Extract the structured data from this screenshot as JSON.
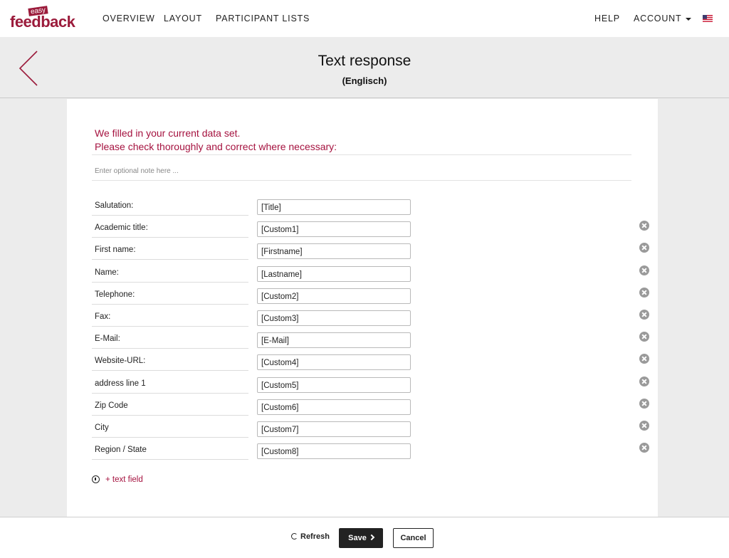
{
  "brand": {
    "small": "easy",
    "main": "feedback"
  },
  "nav": {
    "left": [
      "OVERVIEW",
      "LAYOUT",
      "PARTICIPANT LISTS"
    ],
    "help": "HELP",
    "account": "ACCOUNT",
    "language_icon": "us-flag-icon"
  },
  "header": {
    "title": "Text response",
    "subtitle": "(Englisch)"
  },
  "message": {
    "line1": "We filled in your current data set.",
    "line2": "Please check thoroughly and correct where necessary:"
  },
  "note_placeholder": "Enter optional note here ...",
  "fields": [
    {
      "label": "Salutation:",
      "value": "[Title]",
      "removable": false
    },
    {
      "label": "Academic title:",
      "value": "[Custom1]",
      "removable": true
    },
    {
      "label": "First name:",
      "value": "[Firstname]",
      "removable": true
    },
    {
      "label": "Name:",
      "value": "[Lastname]",
      "removable": true
    },
    {
      "label": "Telephone:",
      "value": "[Custom2]",
      "removable": true
    },
    {
      "label": "Fax:",
      "value": "[Custom3]",
      "removable": true
    },
    {
      "label": "E-Mail:",
      "value": "[E-Mail]",
      "removable": true
    },
    {
      "label": "Website-URL:",
      "value": "[Custom4]",
      "removable": true
    },
    {
      "label": "address line 1",
      "value": "[Custom5]",
      "removable": true
    },
    {
      "label": "Zip Code",
      "value": "[Custom6]",
      "removable": true
    },
    {
      "label": "City",
      "value": "[Custom7]",
      "removable": true
    },
    {
      "label": "Region / State",
      "value": "[Custom8]",
      "removable": true
    }
  ],
  "add_field": "+ text field",
  "footer": {
    "refresh": "Refresh",
    "save": "Save",
    "cancel": "Cancel"
  },
  "colors": {
    "accent": "#a5123f",
    "brand": "#9b1b3b"
  }
}
